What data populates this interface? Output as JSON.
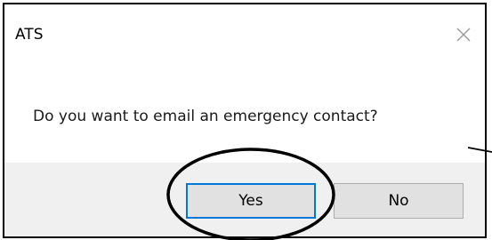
{
  "dialog": {
    "title": "ATS",
    "message": "Do you want to email an emergency contact?",
    "close_icon": "close-icon",
    "buttons": {
      "yes_label": "Yes",
      "no_label": "No"
    }
  },
  "colors": {
    "footer_bg": "#f0f0f0",
    "button_bg": "#e1e1e1",
    "focus_border": "#0078d7",
    "annotation": "#000000"
  }
}
